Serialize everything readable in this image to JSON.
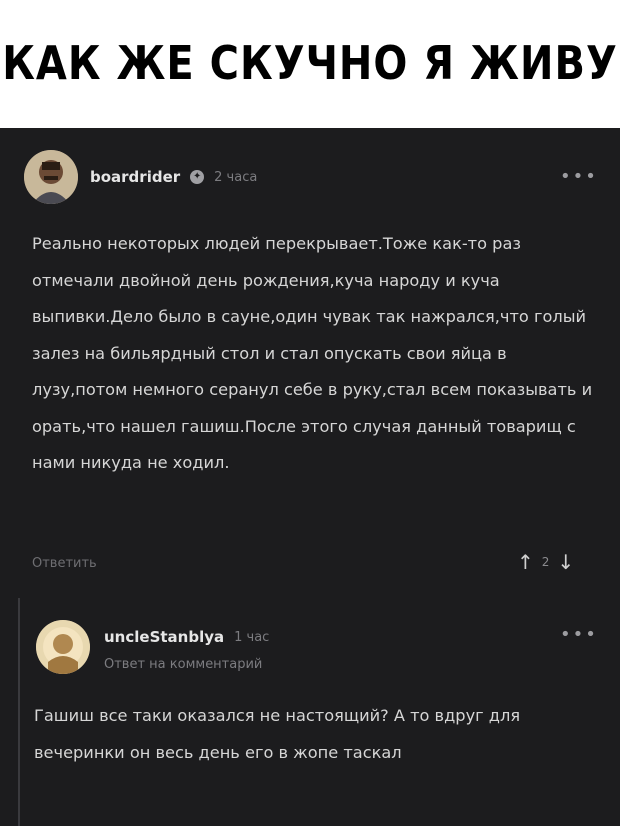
{
  "meme": {
    "title": "КАК ЖЕ СКУЧНО Я ЖИВУ"
  },
  "comment": {
    "username": "boardrider",
    "time": "2 часа",
    "text": "Реально некоторых людей перекрывает.Тоже как-то раз отмечали двойной день рождения,куча народу и куча выпивки.Дело было в сауне,один чувак так нажрался,что голый залез на бильярдный стол и стал опускать свои яйца в лузу,потом немного серанул себе в руку,стал всем показывать и орать,что нашел гашиш.После этого случая данный товарищ с нами никуда не ходил.",
    "reply_label": "Ответить",
    "vote_count": "2",
    "more_label": "•••"
  },
  "reply": {
    "username": "uncleStanblya",
    "time": "1 час",
    "subtitle": "Ответ на комментарий",
    "text": "Гашиш все таки оказался не настоящий? А то вдруг для вечеринки он весь день его в жопе таскал",
    "more_label": "•••"
  },
  "colors": {
    "panel_bg": "#1c1c1e",
    "text": "#d6d6d6",
    "muted": "#7c7c80"
  }
}
